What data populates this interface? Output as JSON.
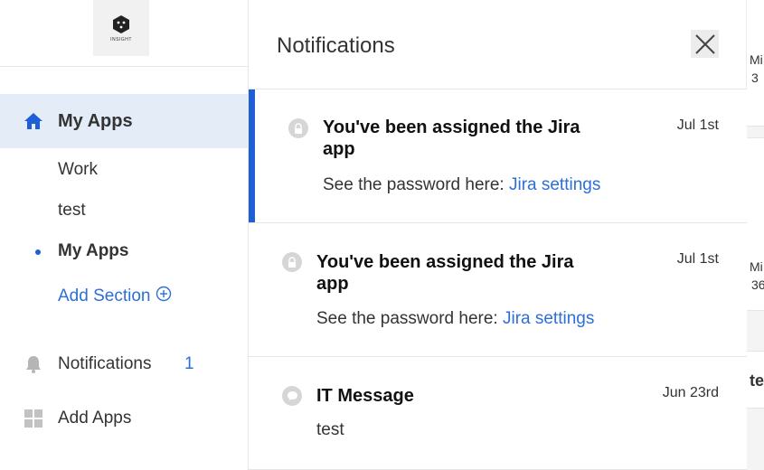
{
  "sidebar": {
    "logo_text": "INSIGHT",
    "nav_active_label": "My Apps",
    "sections": [
      "Work",
      "test",
      "My Apps"
    ],
    "add_section_label": "Add Section",
    "notifications_label": "Notifications",
    "notifications_count": "1",
    "add_apps_label": "Add Apps"
  },
  "panel": {
    "title": "Notifications",
    "items": [
      {
        "title": "You've been assigned the Jira app",
        "date": "Jul 1st",
        "body_prefix": "See the password here: ",
        "link": "Jira settings",
        "icon": "lock-icon",
        "unread": true
      },
      {
        "title": "You've been assigned the Jira app",
        "date": "Jul 1st",
        "body_prefix": "See the password here: ",
        "link": "Jira settings",
        "icon": "lock-icon",
        "unread": false
      },
      {
        "title": "IT Message",
        "date": "Jun 23rd",
        "body_prefix": "test",
        "link": "",
        "icon": "message-icon",
        "unread": false
      }
    ]
  },
  "background": {
    "card1_line1": "Mi",
    "card1_line2": "3",
    "card2_line1": "Mi",
    "card2_line2": "36",
    "card3_line1": "te"
  },
  "colors": {
    "accent": "#1e5fd6",
    "link": "#2c6fd6",
    "active_bg": "#e4ecf8"
  }
}
